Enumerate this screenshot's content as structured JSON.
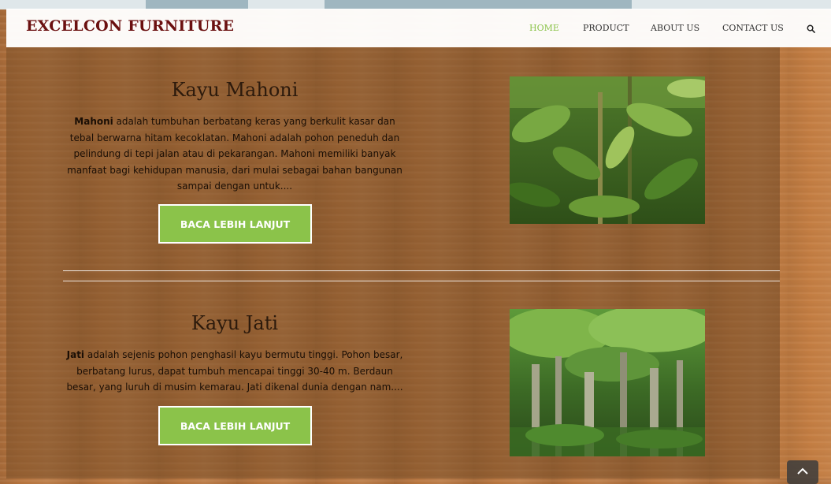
{
  "header": {
    "logo": "EXCELCON FURNITURE",
    "nav": [
      {
        "label": "HOME",
        "active": true
      },
      {
        "label": "PRODUCT",
        "active": false
      },
      {
        "label": "ABOUT US",
        "active": false
      },
      {
        "label": "CONTACT US",
        "active": false
      }
    ],
    "search_icon": "search-icon"
  },
  "cards": [
    {
      "title": "Kayu Mahoni",
      "highlight": "Mahoni",
      "text": " adalah tumbuhan berbatang keras yang berkulit kasar dan tebal berwarna hitam kecoklatan. Mahoni adalah pohon peneduh dan pelindung di tepi jalan atau di pekarangan. Mahoni memiliki banyak manfaat bagi kehidupan manusia, dari mulai sebagai bahan bangunan sampai dengan untuk....",
      "button": "BACA LEBIH LANJUT",
      "image_icon": "mahogany-tree-photo"
    },
    {
      "title": "Kayu Jati",
      "highlight": "Jati",
      "text": " adalah sejenis pohon penghasil kayu bermutu tinggi. Pohon besar, berbatang lurus, dapat tumbuh mencapai tinggi 30-40 m. Berdaun besar, yang luruh di musim kemarau. Jati dikenal dunia dengan nam....",
      "button": "BACA LEBIH LANJUT",
      "image_icon": "teak-forest-photo"
    }
  ],
  "scroll_top_icon": "chevron-up-icon",
  "colors": {
    "accent": "#8bc34a",
    "logo": "#6b1010",
    "wood": "#b9763f"
  }
}
